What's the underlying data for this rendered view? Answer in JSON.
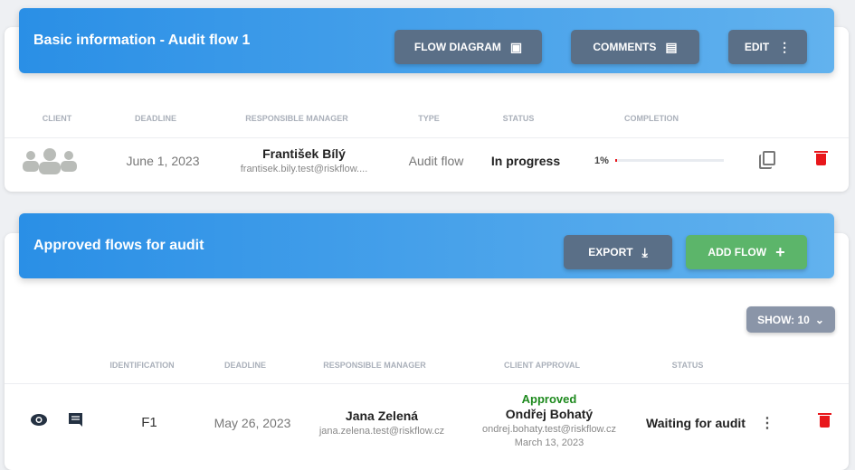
{
  "basic": {
    "title": "Basic information - Audit flow 1",
    "buttons": {
      "flow_diagram": "FLOW DIAGRAM",
      "comments": "COMMENTS",
      "edit": "EDIT"
    },
    "columns": [
      "CLIENT",
      "DEADLINE",
      "RESPONSIBLE MANAGER",
      "TYPE",
      "STATUS",
      "COMPLETION"
    ],
    "row": {
      "deadline": "June 1, 2023",
      "manager_name": "František Bílý",
      "manager_email": "frantisek.bily.test@riskflow....",
      "type": "Audit flow",
      "status": "In progress",
      "completion_label": "1%",
      "completion": 1
    }
  },
  "approved": {
    "title": "Approved flows for audit",
    "buttons": {
      "export": "EXPORT",
      "add_flow": "ADD FLOW",
      "show": "SHOW: 10"
    },
    "columns": [
      "IDENTIFICATION",
      "DEADLINE",
      "RESPONSIBLE MANAGER",
      "CLIENT APPROVAL",
      "STATUS"
    ],
    "rows": [
      {
        "id": "F1",
        "deadline": "May 26, 2023",
        "manager_name": "Jana Zelená",
        "manager_email": "jana.zelena.test@riskflow.cz",
        "approval_status": "Approved",
        "approver_name": "Ondřej Bohatý",
        "approver_email": "ondrej.bohaty.test@riskflow.cz",
        "approval_date": "March 13, 2023",
        "status": "Waiting for audit"
      }
    ]
  },
  "colors": {
    "header_blue": "#2a8fe6",
    "button": "#5a6f87",
    "add": "#5cb56a",
    "delete": "#e8171b",
    "approved": "#1e8a1e"
  }
}
